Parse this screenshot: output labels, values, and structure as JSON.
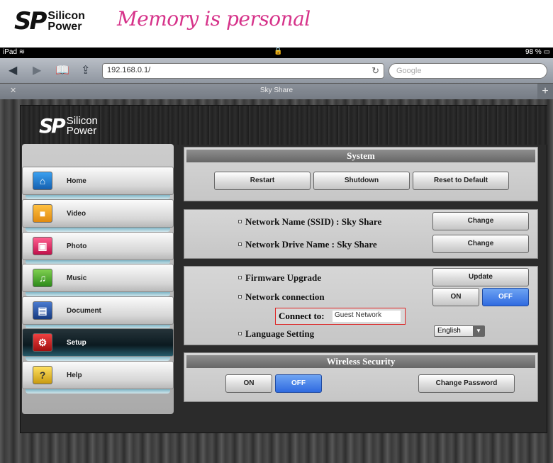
{
  "banner": {
    "brand_mark": "SP",
    "brand_top": "Silicon",
    "brand_bottom": "Power",
    "tagline": "Memory is personal"
  },
  "statusbar": {
    "device": "iPad",
    "battery": "98 %"
  },
  "browser": {
    "url": "192.168.0.1/",
    "search_placeholder": "Google",
    "tab_title": "Sky Share"
  },
  "header": {
    "brand_mark": "SP",
    "brand_top": "Silicon",
    "brand_bottom": "Power"
  },
  "sidebar": {
    "items": [
      {
        "label": "Home",
        "icon": "home-icon",
        "color": "#2b7fd6"
      },
      {
        "label": "Video",
        "icon": "video-icon",
        "color": "#f0a020"
      },
      {
        "label": "Photo",
        "icon": "photo-icon",
        "color": "#e0306a"
      },
      {
        "label": "Music",
        "icon": "music-icon",
        "color": "#4caa30"
      },
      {
        "label": "Document",
        "icon": "document-icon",
        "color": "#2050a0"
      },
      {
        "label": "Setup",
        "icon": "setup-icon",
        "color": "#d02a2a"
      },
      {
        "label": "Help",
        "icon": "help-icon",
        "color": "#e8c020"
      }
    ]
  },
  "system": {
    "title": "System",
    "restart": "Restart",
    "shutdown": "Shutdown",
    "reset": "Reset to Default"
  },
  "network": {
    "ssid_label": "Network Name (SSID) : Sky Share",
    "drive_label": "Network Drive Name : Sky Share",
    "change": "Change"
  },
  "settings": {
    "firmware_label": "Firmware Upgrade",
    "update": "Update",
    "connection_label": "Network connection",
    "on": "ON",
    "off": "OFF",
    "connect_to_label": "Connect to:",
    "connect_to_value": "Guest Network",
    "language_label": "Language Setting",
    "language_value": "English"
  },
  "wireless": {
    "title": "Wireless Security",
    "on": "ON",
    "off": "OFF",
    "change_password": "Change Password"
  }
}
